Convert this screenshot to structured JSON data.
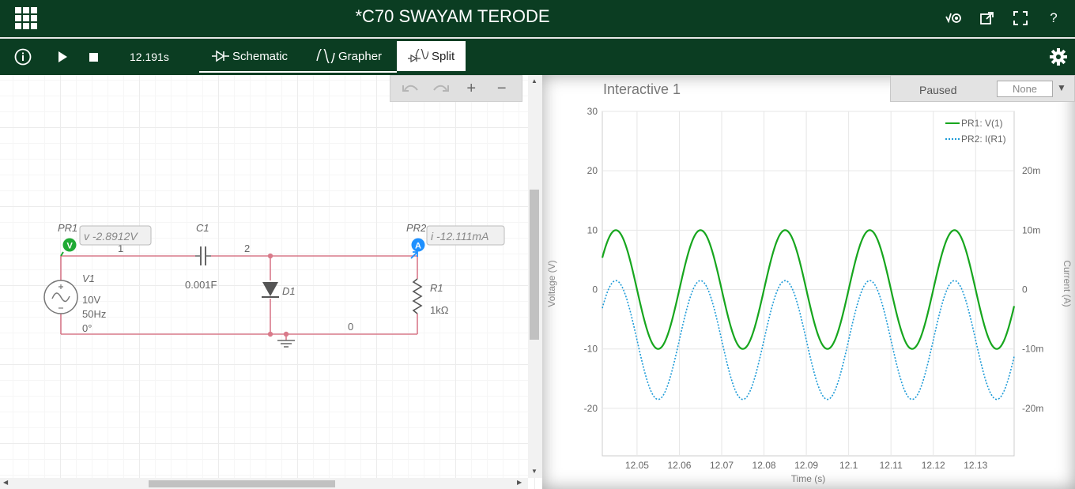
{
  "app": {
    "title": "*C70 SWAYAM TERODE"
  },
  "toolbar": {
    "time": "12.191s",
    "tabs": [
      {
        "label": "Schematic"
      },
      {
        "label": "Grapher"
      },
      {
        "label": "Split"
      }
    ],
    "active_tab": "Split"
  },
  "colors": {
    "header_bg": "#0b3d22",
    "wire": "#d97a8a",
    "probe_v": "#1faa34",
    "probe_i": "#1e90ff",
    "series1": "#17a61e",
    "series2": "#1e9bd7"
  },
  "schematic": {
    "pr1": {
      "label": "PR1",
      "readout": "v -2.8912V",
      "badge": "V"
    },
    "pr2": {
      "label": "PR2",
      "readout": "i -12.111mA",
      "badge": "A"
    },
    "c1": {
      "label": "C1",
      "value": "0.001F"
    },
    "d1": {
      "label": "D1"
    },
    "r1": {
      "label": "R1",
      "value": "1kΩ"
    },
    "v1": {
      "label": "V1",
      "amp": "10V",
      "freq": "50Hz",
      "phase": "0°"
    },
    "nodes": {
      "n1": "1",
      "n2": "2",
      "n0": "0"
    }
  },
  "grapher": {
    "title": "Interactive 1",
    "status": "Paused",
    "select_value": "None"
  },
  "chart_data": {
    "type": "line",
    "xlabel": "Time (s)",
    "ylabel": "Voltage (V)",
    "y2label": "Current (A)",
    "xlim": [
      12.0418,
      12.1391
    ],
    "ylim": [
      -28,
      30
    ],
    "y2lim": [
      -0.028,
      0.03
    ],
    "x_ticks": [
      "12.05",
      "12.06",
      "12.07",
      "12.08",
      "12.09",
      "12.1",
      "12.11",
      "12.12",
      "12.13"
    ],
    "x_tick_values": [
      12.05,
      12.06,
      12.07,
      12.08,
      12.09,
      12.1,
      12.11,
      12.12,
      12.13
    ],
    "y_ticks": [
      "30",
      "20",
      "10",
      "0",
      "-10",
      "-20"
    ],
    "y_tick_values": [
      30,
      20,
      10,
      0,
      -10,
      -20
    ],
    "y2_ticks": [
      "20m",
      "10m",
      "0",
      "-10m",
      "-20m"
    ],
    "y2_tick_values": [
      0.02,
      0.01,
      0,
      -0.01,
      -0.02
    ],
    "legend_position": "top-right",
    "grid": true,
    "series": [
      {
        "name": "PR1: V(1)",
        "axis": "left",
        "style": "solid",
        "amplitude": 10,
        "offset": 0,
        "frequency_hz": 50,
        "peak_time": 12.065,
        "x_range": [
          12.0418,
          12.1391
        ]
      },
      {
        "name": "PR2: I(R1)",
        "axis": "right",
        "style": "dotted",
        "amplitude": 0.01,
        "offset": -0.0085,
        "frequency_hz": 50,
        "peak_time": 12.065,
        "x_range": [
          12.0418,
          12.1391
        ]
      }
    ]
  }
}
